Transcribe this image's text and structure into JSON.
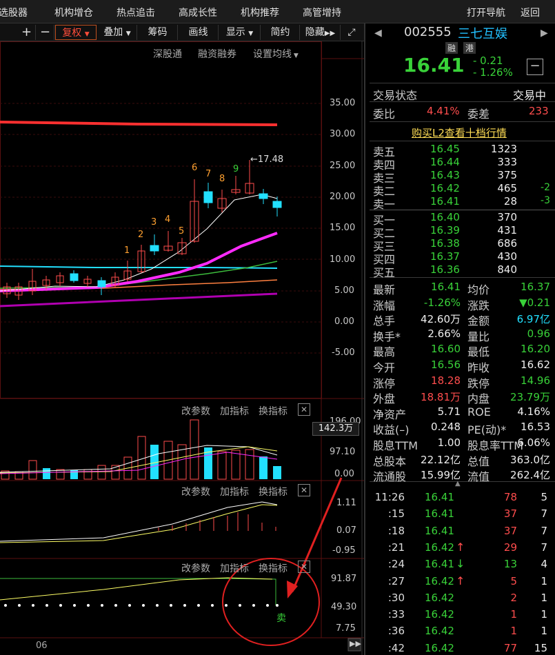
{
  "topnav": [
    "选股器",
    "机构增仓",
    "热点追击",
    "高成长性",
    "机构推荐",
    "高管增持"
  ],
  "topnav_right": [
    "打开导航",
    "返回"
  ],
  "toolbar": {
    "plus": "+",
    "minus": "−",
    "fuquan": "复权",
    "diejia": "叠加",
    "chouma": "筹码",
    "huaxian": "画线",
    "xianshi": "显示",
    "jianyue": "简约",
    "yincang": "隐藏"
  },
  "chart_links": [
    "深股通",
    "融资融券",
    "设置均线"
  ],
  "price_axis": [
    "35.00",
    "30.00",
    "25.00",
    "20.00",
    "15.00",
    "10.00",
    "5.00",
    "0.00",
    "-5.00"
  ],
  "annotations": {
    "high_marker": "17.48",
    "numbers": [
      "1",
      "2",
      "3",
      "4",
      "5",
      "6",
      "7",
      "8",
      "9"
    ]
  },
  "sub_panel_buttons": [
    "改参数",
    "加指标",
    "换指标"
  ],
  "volume_axis": [
    "196.00",
    "97.10",
    "0.00"
  ],
  "volume_current": "142.3万",
  "macd_axis": [
    "1.11",
    "0.07",
    "-0.95"
  ],
  "kdj_axis": [
    "91.87",
    "49.30",
    "7.75"
  ],
  "signal": "卖",
  "date_label": "06",
  "stock": {
    "code": "002555",
    "name": "三七互娱",
    "tags": [
      "融",
      "港"
    ],
    "price": "16.41",
    "change": "- 0.21",
    "change_pct": "- 1.26%"
  },
  "trade_status": {
    "label": "交易状态",
    "value": "交易中"
  },
  "weibi": {
    "label1": "委比",
    "value1": "4.41%",
    "label2": "委差",
    "value2": "233"
  },
  "l2_link": "购买L2查看十档行情",
  "sell_orders": [
    {
      "label": "卖五",
      "price": "16.45",
      "vol": "1323",
      "chg": ""
    },
    {
      "label": "卖四",
      "price": "16.44",
      "vol": "333",
      "chg": ""
    },
    {
      "label": "卖三",
      "price": "16.43",
      "vol": "375",
      "chg": ""
    },
    {
      "label": "卖二",
      "price": "16.42",
      "vol": "465",
      "chg": "-2"
    },
    {
      "label": "卖一",
      "price": "16.41",
      "vol": "28",
      "chg": "-3"
    }
  ],
  "buy_orders": [
    {
      "label": "买一",
      "price": "16.40",
      "vol": "370"
    },
    {
      "label": "买二",
      "price": "16.39",
      "vol": "431"
    },
    {
      "label": "买三",
      "price": "16.38",
      "vol": "686"
    },
    {
      "label": "买四",
      "price": "16.37",
      "vol": "430"
    },
    {
      "label": "买五",
      "price": "16.36",
      "vol": "840"
    }
  ],
  "stats": [
    {
      "l1": "最新",
      "v1": "16.41",
      "c1": "green",
      "l2": "均价",
      "v2": "16.37",
      "c2": "green"
    },
    {
      "l1": "涨幅",
      "v1": "-1.26%",
      "c1": "green",
      "l2": "涨跌",
      "v2": "▼0.21",
      "c2": "green"
    },
    {
      "l1": "总手",
      "v1": "42.60万",
      "c1": "white",
      "l2": "金额",
      "v2": "6.97亿",
      "c2": "cyan"
    },
    {
      "l1": "换手*",
      "v1": "2.66%",
      "c1": "white",
      "l2": "量比",
      "v2": "0.96",
      "c2": "green"
    },
    {
      "l1": "最高",
      "v1": "16.60",
      "c1": "green",
      "l2": "最低",
      "v2": "16.20",
      "c2": "green"
    },
    {
      "l1": "今开",
      "v1": "16.56",
      "c1": "green",
      "l2": "昨收",
      "v2": "16.62",
      "c2": "white"
    },
    {
      "l1": "涨停",
      "v1": "18.28",
      "c1": "red",
      "l2": "跌停",
      "v2": "14.96",
      "c2": "green"
    },
    {
      "l1": "外盘",
      "v1": "18.81万",
      "c1": "red",
      "l2": "内盘",
      "v2": "23.79万",
      "c2": "green"
    },
    {
      "l1": "净资产",
      "v1": "5.71",
      "c1": "white",
      "l2": "ROE",
      "v2": "4.16%",
      "c2": "white"
    },
    {
      "l1": "收益(–)",
      "v1": "0.248",
      "c1": "white",
      "l2": "PE(动)*",
      "v2": "16.53",
      "c2": "white"
    },
    {
      "l1": "股息TTM",
      "v1": "1.00",
      "c1": "white",
      "l2": "股息率TTM",
      "v2": "6.06%",
      "c2": "white"
    },
    {
      "l1": "总股本",
      "v1": "22.12亿",
      "c1": "white",
      "l2": "总值",
      "v2": "363.0亿",
      "c2": "white"
    },
    {
      "l1": "流通股",
      "v1": "15.99亿",
      "c1": "white",
      "l2": "流值",
      "v2": "262.4亿",
      "c2": "white"
    }
  ],
  "ticks": [
    {
      "time": "11:26",
      "price": "16.41",
      "arrow": "",
      "vol": "78",
      "vc": "red",
      "n": "5"
    },
    {
      "time": ":15",
      "price": "16.41",
      "arrow": "",
      "vol": "37",
      "vc": "red",
      "n": "7"
    },
    {
      "time": ":18",
      "price": "16.41",
      "arrow": "",
      "vol": "37",
      "vc": "red",
      "n": "7"
    },
    {
      "time": ":21",
      "price": "16.42",
      "arrow": "↑",
      "vol": "29",
      "vc": "red",
      "n": "7"
    },
    {
      "time": ":24",
      "price": "16.41",
      "arrow": "↓",
      "vol": "13",
      "vc": "green",
      "n": "4"
    },
    {
      "time": ":27",
      "price": "16.42",
      "arrow": "↑",
      "vol": "5",
      "vc": "red",
      "n": "1"
    },
    {
      "time": ":30",
      "price": "16.42",
      "arrow": "",
      "vol": "2",
      "vc": "red",
      "n": "1"
    },
    {
      "time": ":33",
      "price": "16.42",
      "arrow": "",
      "vol": "1",
      "vc": "red",
      "n": "1"
    },
    {
      "time": ":36",
      "price": "16.42",
      "arrow": "",
      "vol": "1",
      "vc": "red",
      "n": "1"
    },
    {
      "time": ":42",
      "price": "16.42",
      "arrow": "",
      "vol": "77",
      "vc": "red",
      "n": "15"
    }
  ],
  "colors": {
    "up": "#ff4d4d",
    "down": "#39d239",
    "accent_cyan": "#22e0ff",
    "ma_magenta": "#ff2bff",
    "circle": "#e02020"
  }
}
